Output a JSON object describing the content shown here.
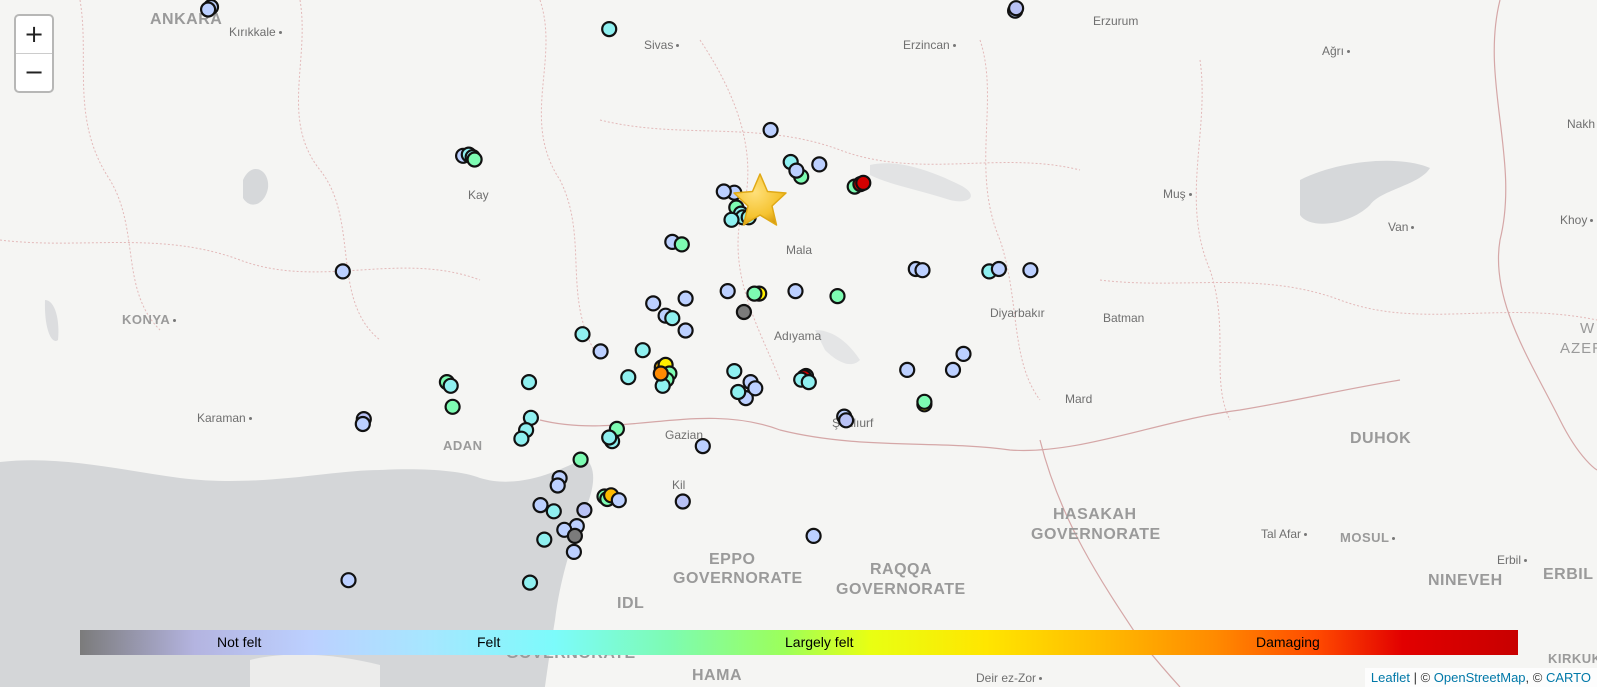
{
  "zoom": {
    "in_label": "+",
    "out_label": "−"
  },
  "places": {
    "ankara": "ANKARA",
    "kirikkale": "Kırıkkale",
    "sivas": "Sivas",
    "erzincan": "Erzincan",
    "erzurum": "Erzurum",
    "agri": "Ağrı",
    "kayseri": "Kay",
    "malatya": "Mala",
    "mus": "Muş",
    "van": "Van",
    "nakh": "Nakh",
    "khoy": "Khoy",
    "konya": "KONYA",
    "diyarbakir": "Diyarbakır",
    "batman": "Batman",
    "adiyaman": "Adıyama",
    "karaman": "Karaman",
    "adana": "ADAN",
    "gaziantep": "Gazian",
    "sanliurfa": "Şanlıurf",
    "mardin": "Mard",
    "kilis": "Kil",
    "duhok": "DUHOK",
    "azer_w": "W",
    "azer": "AZER",
    "hasakah1": "HASAKAH",
    "hasakah2": "GOVERNORATE",
    "talafar": "Tal Afar",
    "mosul": "MOSUL",
    "erbil_small": "Erbil",
    "erbil": "ERBIL",
    "aleppo1": "EPPO",
    "aleppo2": "GOVERNORATE",
    "raqqa1": "RAQQA",
    "raqqa2": "GOVERNORATE",
    "idlib": "IDL",
    "nineveh": "NINEVEH",
    "hama": "HAMA",
    "homs": "GOVERNORATE",
    "deirezzor": "Deir ez-Zor",
    "kirkuk": "KIRKUK"
  },
  "legend": {
    "not_felt": "Not felt",
    "felt": "Felt",
    "largely_felt": "Largely felt",
    "damaging": "Damaging"
  },
  "colors": {
    "not_felt": "#7b7b7b",
    "weak": "#b9c2f5",
    "light": "#bcd0ff",
    "felt": "#8ff0f0",
    "moderate": "#7dfbb2",
    "strong": "#9cff5a",
    "largely_felt": "#ffee00",
    "very_strong": "#ffbb00",
    "severe": "#ff8a00",
    "damaging": "#d40000",
    "epicenter": "#f5c330"
  },
  "attribution": {
    "leaflet": "Leaflet",
    "sep": " | © ",
    "osm": "OpenStreetMap",
    "sep2": ", © ",
    "carto": "CARTO"
  },
  "epicenter_icon": "star-icon",
  "reports": [
    {
      "lat": 39.93,
      "lon": 32.85,
      "c": "light"
    },
    {
      "lat": 39.91,
      "lon": 32.82,
      "c": "light"
    },
    {
      "lat": 39.75,
      "lon": 37.02,
      "c": "felt"
    },
    {
      "lat": 39.9,
      "lon": 41.27,
      "c": "light"
    },
    {
      "lat": 39.92,
      "lon": 41.28,
      "c": "weak"
    },
    {
      "lat": 38.93,
      "lon": 38.71,
      "c": "light"
    },
    {
      "lat": 38.67,
      "lon": 38.92,
      "c": "felt"
    },
    {
      "lat": 38.65,
      "lon": 39.22,
      "c": "light"
    },
    {
      "lat": 38.47,
      "lon": 39.59,
      "c": "moderate"
    },
    {
      "lat": 38.49,
      "lon": 39.65,
      "c": "damaging"
    },
    {
      "lat": 38.5,
      "lon": 39.68,
      "c": "damaging"
    },
    {
      "lat": 38.72,
      "lon": 35.49,
      "c": "light"
    },
    {
      "lat": 38.73,
      "lon": 35.55,
      "c": "felt"
    },
    {
      "lat": 38.71,
      "lon": 35.59,
      "c": "felt"
    },
    {
      "lat": 38.69,
      "lon": 35.61,
      "c": "moderate"
    },
    {
      "lat": 38.42,
      "lon": 38.33,
      "c": "light"
    },
    {
      "lat": 38.3,
      "lon": 38.35,
      "c": "moderate"
    },
    {
      "lat": 38.25,
      "lon": 38.4,
      "c": "felt"
    },
    {
      "lat": 38.22,
      "lon": 38.42,
      "c": "felt"
    },
    {
      "lat": 38.2,
      "lon": 38.3,
      "c": "felt"
    },
    {
      "lat": 38.22,
      "lon": 38.48,
      "c": "felt"
    },
    {
      "lat": 38.02,
      "lon": 37.68,
      "c": "light"
    },
    {
      "lat": 38.0,
      "lon": 37.78,
      "c": "moderate"
    },
    {
      "lat": 37.78,
      "lon": 34.23,
      "c": "light"
    },
    {
      "lat": 37.8,
      "lon": 40.23,
      "c": "light"
    },
    {
      "lat": 37.79,
      "lon": 40.3,
      "c": "light"
    },
    {
      "lat": 37.78,
      "lon": 41.0,
      "c": "felt"
    },
    {
      "lat": 37.8,
      "lon": 41.1,
      "c": "light"
    },
    {
      "lat": 37.79,
      "lon": 41.43,
      "c": "light"
    },
    {
      "lat": 37.62,
      "lon": 38.26,
      "c": "light"
    },
    {
      "lat": 37.6,
      "lon": 38.59,
      "c": "largely_felt"
    },
    {
      "lat": 37.6,
      "lon": 38.54,
      "c": "moderate"
    },
    {
      "lat": 37.45,
      "lon": 38.43,
      "c": "not_felt"
    },
    {
      "lat": 37.62,
      "lon": 38.97,
      "c": "light"
    },
    {
      "lat": 37.58,
      "lon": 39.41,
      "c": "moderate"
    },
    {
      "lat": 37.52,
      "lon": 37.48,
      "c": "light"
    },
    {
      "lat": 37.42,
      "lon": 37.61,
      "c": "light"
    },
    {
      "lat": 37.4,
      "lon": 37.68,
      "c": "felt"
    },
    {
      "lat": 37.56,
      "lon": 37.82,
      "c": "light"
    },
    {
      "lat": 37.3,
      "lon": 37.82,
      "c": "light"
    },
    {
      "lat": 37.27,
      "lon": 36.74,
      "c": "felt"
    },
    {
      "lat": 37.13,
      "lon": 36.93,
      "c": "light"
    },
    {
      "lat": 37.14,
      "lon": 37.37,
      "c": "felt"
    },
    {
      "lat": 36.92,
      "lon": 37.22,
      "c": "felt"
    },
    {
      "lat": 37.0,
      "lon": 37.57,
      "c": "very_strong"
    },
    {
      "lat": 37.02,
      "lon": 37.61,
      "c": "largely_felt"
    },
    {
      "lat": 36.95,
      "lon": 37.65,
      "c": "moderate"
    },
    {
      "lat": 36.9,
      "lon": 37.62,
      "c": "moderate"
    },
    {
      "lat": 36.85,
      "lon": 37.58,
      "c": "felt"
    },
    {
      "lat": 36.95,
      "lon": 37.56,
      "c": "severe"
    },
    {
      "lat": 36.97,
      "lon": 38.33,
      "c": "felt"
    },
    {
      "lat": 36.88,
      "lon": 38.5,
      "c": "light"
    },
    {
      "lat": 36.75,
      "lon": 38.45,
      "c": "light"
    },
    {
      "lat": 36.8,
      "lon": 38.37,
      "c": "felt"
    },
    {
      "lat": 36.83,
      "lon": 38.55,
      "c": "light"
    },
    {
      "lat": 36.93,
      "lon": 39.08,
      "c": "felt"
    },
    {
      "lat": 36.92,
      "lon": 39.06,
      "c": "damaging"
    },
    {
      "lat": 36.9,
      "lon": 39.03,
      "c": "felt"
    },
    {
      "lat": 36.88,
      "lon": 39.11,
      "c": "felt"
    },
    {
      "lat": 36.98,
      "lon": 40.14,
      "c": "light"
    },
    {
      "lat": 37.11,
      "lon": 40.73,
      "c": "light"
    },
    {
      "lat": 36.98,
      "lon": 40.62,
      "c": "light"
    },
    {
      "lat": 36.88,
      "lon": 35.32,
      "c": "moderate"
    },
    {
      "lat": 36.85,
      "lon": 35.36,
      "c": "felt"
    },
    {
      "lat": 36.68,
      "lon": 35.38,
      "c": "moderate"
    },
    {
      "lat": 36.58,
      "lon": 34.45,
      "c": "weak"
    },
    {
      "lat": 36.54,
      "lon": 34.44,
      "c": "light"
    },
    {
      "lat": 36.88,
      "lon": 36.18,
      "c": "felt"
    },
    {
      "lat": 36.59,
      "lon": 36.2,
      "c": "felt"
    },
    {
      "lat": 36.49,
      "lon": 36.15,
      "c": "felt"
    },
    {
      "lat": 36.42,
      "lon": 36.1,
      "c": "felt"
    },
    {
      "lat": 36.5,
      "lon": 37.1,
      "c": "moderate"
    },
    {
      "lat": 36.4,
      "lon": 37.05,
      "c": "felt"
    },
    {
      "lat": 36.43,
      "lon": 37.02,
      "c": "felt"
    },
    {
      "lat": 36.25,
      "lon": 36.72,
      "c": "moderate"
    },
    {
      "lat": 36.1,
      "lon": 36.5,
      "c": "light"
    },
    {
      "lat": 36.04,
      "lon": 36.48,
      "c": "light"
    },
    {
      "lat": 36.36,
      "lon": 38.0,
      "c": "light"
    },
    {
      "lat": 36.6,
      "lon": 39.48,
      "c": "light"
    },
    {
      "lat": 36.57,
      "lon": 39.5,
      "c": "weak"
    },
    {
      "lat": 36.7,
      "lon": 40.32,
      "c": "largely_felt"
    },
    {
      "lat": 36.72,
      "lon": 40.32,
      "c": "moderate"
    },
    {
      "lat": 35.95,
      "lon": 36.97,
      "c": "moderate"
    },
    {
      "lat": 35.93,
      "lon": 37.0,
      "c": "moderate"
    },
    {
      "lat": 35.96,
      "lon": 37.04,
      "c": "very_strong"
    },
    {
      "lat": 35.92,
      "lon": 37.12,
      "c": "light"
    },
    {
      "lat": 35.91,
      "lon": 37.79,
      "c": "weak"
    },
    {
      "lat": 35.88,
      "lon": 36.3,
      "c": "light"
    },
    {
      "lat": 35.83,
      "lon": 36.44,
      "c": "felt"
    },
    {
      "lat": 35.84,
      "lon": 36.76,
      "c": "weak"
    },
    {
      "lat": 35.71,
      "lon": 36.68,
      "c": "light"
    },
    {
      "lat": 35.68,
      "lon": 36.55,
      "c": "light"
    },
    {
      "lat": 35.63,
      "lon": 36.66,
      "c": "not_felt"
    },
    {
      "lat": 35.6,
      "lon": 36.34,
      "c": "felt"
    },
    {
      "lat": 35.5,
      "lon": 36.65,
      "c": "light"
    },
    {
      "lat": 35.63,
      "lon": 39.16,
      "c": "light"
    },
    {
      "lat": 35.27,
      "lon": 34.29,
      "c": "light"
    },
    {
      "lat": 35.25,
      "lon": 36.19,
      "c": "felt"
    },
    {
      "lat": 38.55,
      "lon": 39.03,
      "c": "moderate"
    },
    {
      "lat": 38.6,
      "lon": 38.98,
      "c": "light"
    },
    {
      "lat": 38.43,
      "lon": 38.22,
      "c": "light"
    }
  ],
  "epicenter": {
    "lat": 38.35,
    "lon": 38.6
  }
}
